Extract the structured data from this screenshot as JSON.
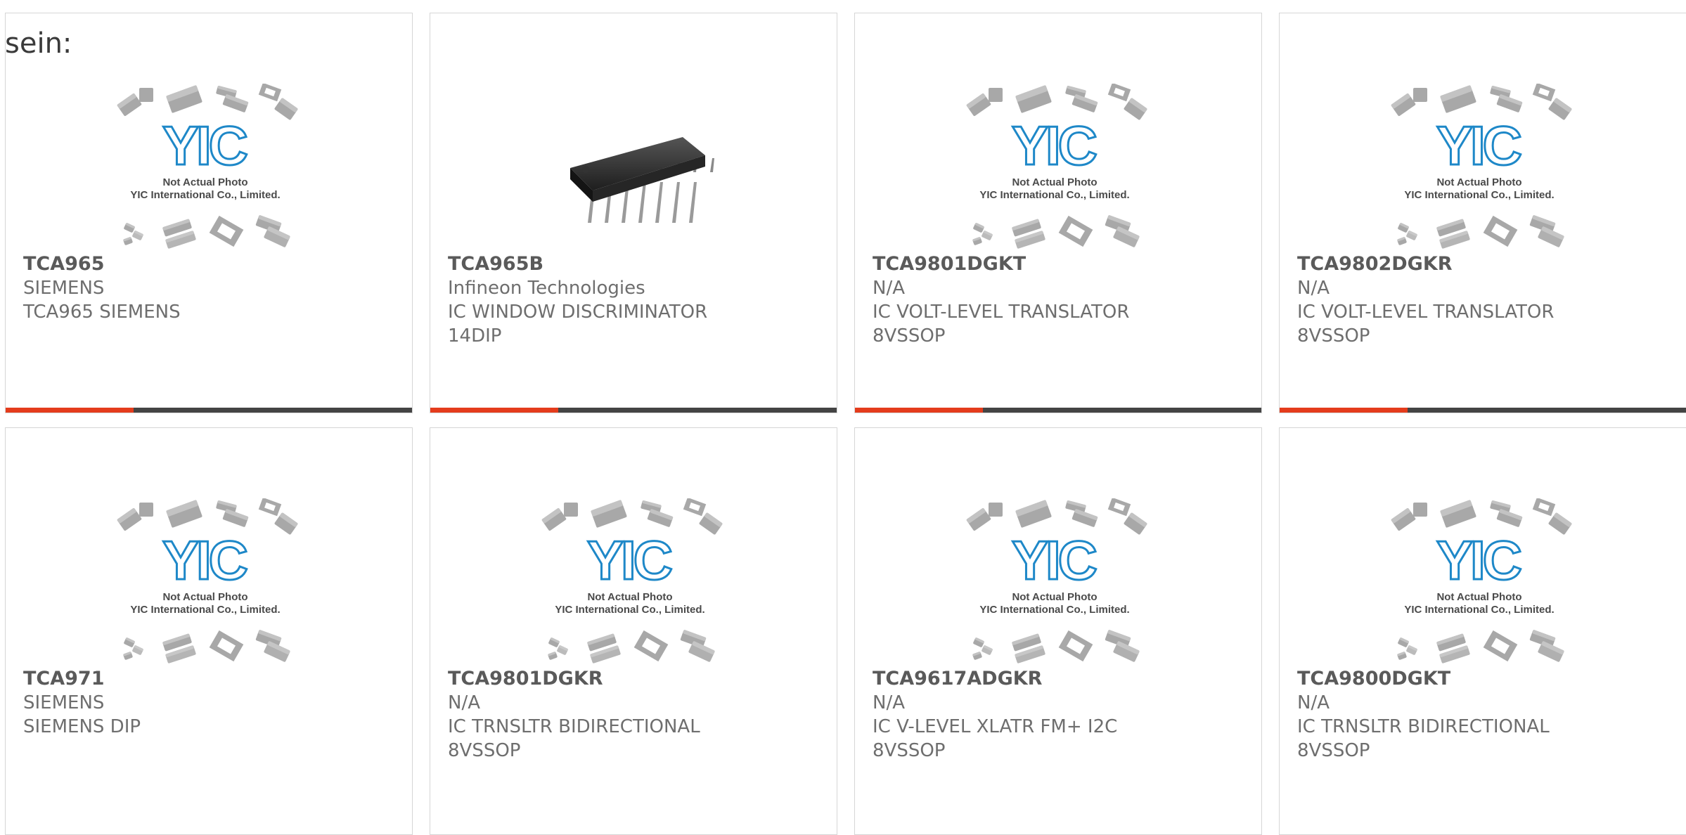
{
  "lead_text": "sein:",
  "colors": {
    "accent": "#e43c1c",
    "bar": "#444444",
    "logo_blue": "#1e88c8",
    "chip_grey": "#a8a8a8"
  },
  "placeholder": {
    "line1": "Not Actual Photo",
    "line2": "YIC International Co., Limited.",
    "logo_text": "YIC"
  },
  "products": [
    {
      "part": "TCA965",
      "maker": "SIEMENS",
      "desc": "TCA965 SIEMENS",
      "pkg": "",
      "image": "placeholder",
      "bar": true
    },
    {
      "part": "TCA965B",
      "maker": "Infineon Technologies",
      "desc": "IC WINDOW DISCRIMINATOR",
      "pkg": "14DIP",
      "image": "dip-chip",
      "bar": true
    },
    {
      "part": "TCA9801DGKT",
      "maker": "N/A",
      "desc": "IC VOLT-LEVEL TRANSLATOR",
      "pkg": "8VSSOP",
      "image": "placeholder",
      "bar": true
    },
    {
      "part": "TCA9802DGKR",
      "maker": "N/A",
      "desc": "IC VOLT-LEVEL TRANSLATOR",
      "pkg": "8VSSOP",
      "image": "placeholder",
      "bar": true
    },
    {
      "part": "TCA971",
      "maker": "SIEMENS",
      "desc": "SIEMENS DIP",
      "pkg": "",
      "image": "placeholder",
      "bar": false
    },
    {
      "part": "TCA9801DGKR",
      "maker": "N/A",
      "desc": "IC TRNSLTR BIDIRECTIONAL",
      "pkg": "8VSSOP",
      "image": "placeholder",
      "bar": false
    },
    {
      "part": "TCA9617ADGKR",
      "maker": "N/A",
      "desc": "IC V-LEVEL XLATR FM+ I2C",
      "pkg": "8VSSOP",
      "image": "placeholder",
      "bar": false
    },
    {
      "part": "TCA9800DGKT",
      "maker": "N/A",
      "desc": "IC TRNSLTR BIDIRECTIONAL",
      "pkg": "8VSSOP",
      "image": "placeholder",
      "bar": false
    }
  ]
}
